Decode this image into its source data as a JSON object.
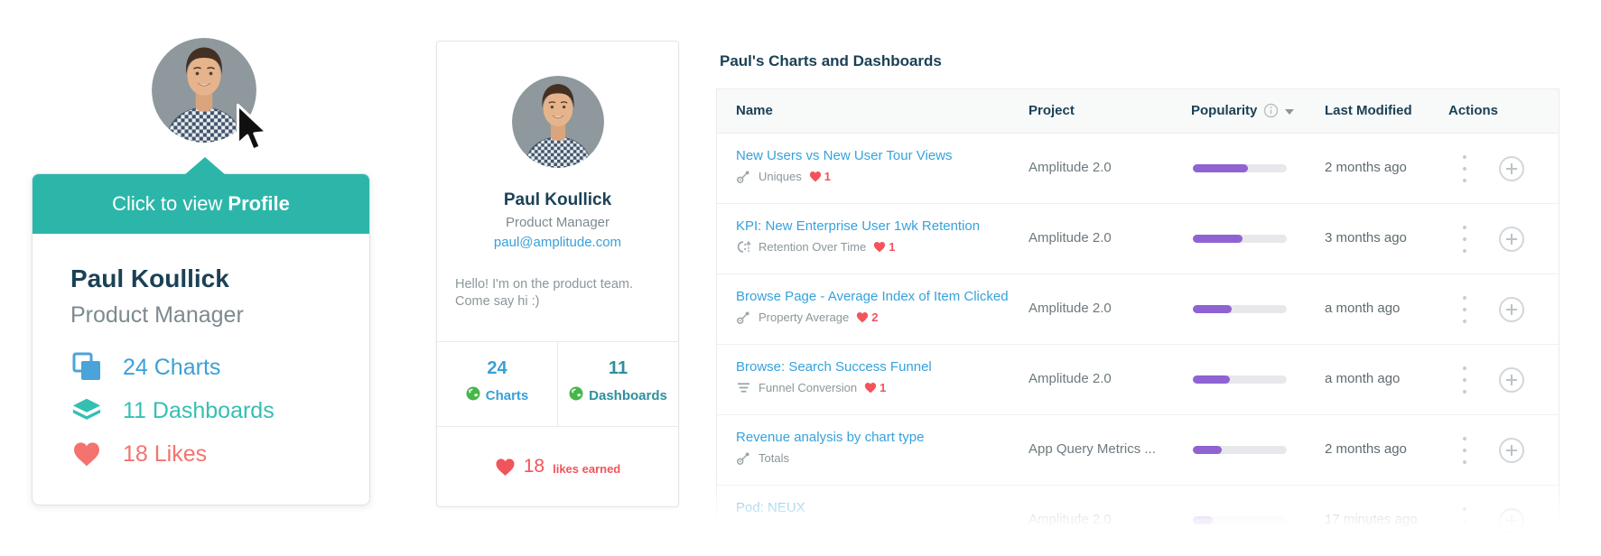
{
  "tooltip_card": {
    "header": {
      "prefix": "Click to view",
      "bold": "Profile"
    },
    "name": "Paul Koullick",
    "role": "Product Manager",
    "stats": [
      {
        "icon": "charts-stack-icon",
        "label": "24 Charts",
        "color": "#3aa0d8"
      },
      {
        "icon": "layers-icon",
        "label": "11 Dashboards",
        "color": "#35bfb3"
      },
      {
        "icon": "heart-icon",
        "label": "18 Likes",
        "color": "#f4736e"
      }
    ]
  },
  "profile_card": {
    "name": "Paul Koullick",
    "role": "Product Manager",
    "email": "paul@amplitude.com",
    "bio_line1": "Hello! I'm on the product team.",
    "bio_line2": "Come say hi :)",
    "stats": [
      {
        "value": "24",
        "label": "Charts",
        "icon": "globe-icon"
      },
      {
        "value": "11",
        "label": "Dashboards",
        "icon": "globe-icon"
      }
    ],
    "likes": {
      "count": "18",
      "label": "likes earned"
    }
  },
  "table": {
    "title": "Paul's Charts and Dashboards",
    "columns": {
      "name": "Name",
      "project": "Project",
      "popularity": "Popularity",
      "last_modified": "Last Modified",
      "actions": "Actions"
    },
    "rows": [
      {
        "name": "New Users vs New User Tour Views",
        "type_icon": "measure-icon",
        "type": "Uniques",
        "likes": "1",
        "project": "Amplitude 2.0",
        "popularity_pct": 59,
        "last_modified": "2 months ago"
      },
      {
        "name": "KPI: New Enterprise User 1wk Retention",
        "type_icon": "retention-icon",
        "type": "Retention Over Time",
        "likes": "1",
        "project": "Amplitude 2.0",
        "popularity_pct": 53,
        "last_modified": "3 months ago"
      },
      {
        "name": "Browse Page - Average Index of Item Clicked",
        "type_icon": "measure-icon",
        "type": "Property Average",
        "likes": "2",
        "project": "Amplitude 2.0",
        "popularity_pct": 41,
        "last_modified": "a month ago"
      },
      {
        "name": "Browse: Search Success Funnel",
        "type_icon": "funnel-icon",
        "type": "Funnel Conversion",
        "likes": "1",
        "project": "Amplitude 2.0",
        "popularity_pct": 39,
        "last_modified": "a month ago"
      },
      {
        "name": "Revenue analysis by chart type",
        "type_icon": "measure-icon",
        "type": "Totals",
        "likes": null,
        "project": "App Query Metrics ...",
        "popularity_pct": 31,
        "last_modified": "2 months ago"
      },
      {
        "name": "Pod: NEUX",
        "type_icon": null,
        "type": null,
        "likes": null,
        "project": "Amplitude 2.0",
        "popularity_pct": 21,
        "last_modified": "17 minutes ago"
      }
    ]
  },
  "colors": {
    "accent_teal": "#2cb6aa",
    "link_blue": "#36a2dc",
    "heart_red": "#f2545b",
    "popularity_purple": "#8f63d2",
    "heading_navy": "#1b4156",
    "muted_gray": "#8b979b"
  }
}
